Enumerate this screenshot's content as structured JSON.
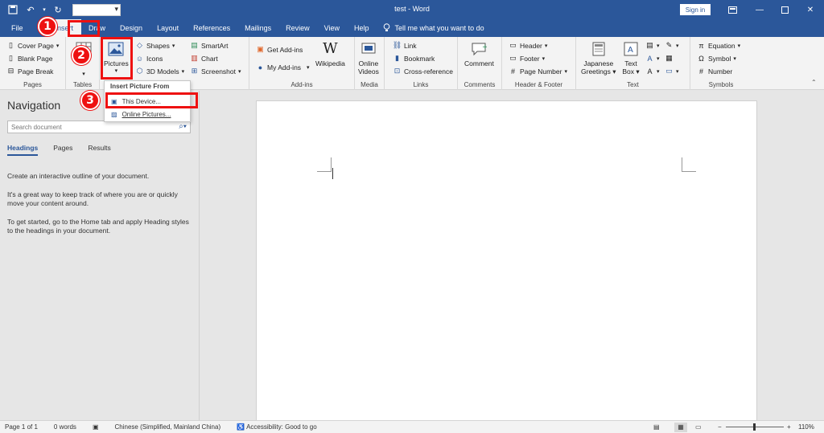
{
  "titlebar": {
    "doc_title": "test  -  Word",
    "signin": "Sign in",
    "accent": "#2b579a"
  },
  "tabs": [
    {
      "label": "File"
    },
    {
      "label": "Insert"
    },
    {
      "label": "Draw"
    },
    {
      "label": "Design"
    },
    {
      "label": "Layout"
    },
    {
      "label": "References"
    },
    {
      "label": "Mailings"
    },
    {
      "label": "Review"
    },
    {
      "label": "View"
    },
    {
      "label": "Help"
    }
  ],
  "tellme": "Tell me what you want to do",
  "ribbon": {
    "pages": {
      "label": "Pages",
      "cover_page": "Cover Page",
      "blank_page": "Blank Page",
      "page_break": "Page Break"
    },
    "tables": {
      "label": "Tables"
    },
    "illustrations": {
      "pictures": "Pictures",
      "shapes": "Shapes",
      "icons": "Icons",
      "models": "3D Models",
      "smartart": "SmartArt",
      "chart": "Chart",
      "screenshot": "Screenshot",
      "label_tail": "s"
    },
    "addins": {
      "label": "Add-ins",
      "get": "Get Add-ins",
      "my": "My Add-ins",
      "wikipedia": "Wikipedia"
    },
    "media": {
      "label": "Media",
      "online_videos_1": "Online",
      "online_videos_2": "Videos"
    },
    "links": {
      "label": "Links",
      "link": "Link",
      "bookmark": "Bookmark",
      "crossref": "Cross-reference"
    },
    "comments": {
      "label": "Comments",
      "comment": "Comment"
    },
    "header_footer": {
      "label": "Header & Footer",
      "header": "Header",
      "footer": "Footer",
      "page_number": "Page Number"
    },
    "text": {
      "label": "Text",
      "japanese_1": "Japanese",
      "japanese_2": "Greetings",
      "textbox_1": "Text",
      "textbox_2": "Box"
    },
    "symbols": {
      "label": "Symbols",
      "equation": "Equation",
      "symbol": "Symbol",
      "number": "Number"
    }
  },
  "dropdown": {
    "header": "Insert Picture From",
    "this_device": "This Device...",
    "online_pictures": "Online Pictures..."
  },
  "navigation": {
    "title": "Navigation",
    "search_placeholder": "Search document",
    "tabs": [
      "Headings",
      "Pages",
      "Results"
    ],
    "para1": "Create an interactive outline of your document.",
    "para2": "It's a great way to keep track of where you are or quickly move your content around.",
    "para3": "To get started, go to the Home tab and apply Heading styles to the headings in your document."
  },
  "statusbar": {
    "page": "Page 1 of 1",
    "words": "0 words",
    "language": "Chinese (Simplified, Mainland China)",
    "accessibility": "Accessibility: Good to go",
    "zoom": "110%"
  },
  "annotations": {
    "step1": "1",
    "step2": "2",
    "step3": "3",
    "color": "#e11111"
  }
}
